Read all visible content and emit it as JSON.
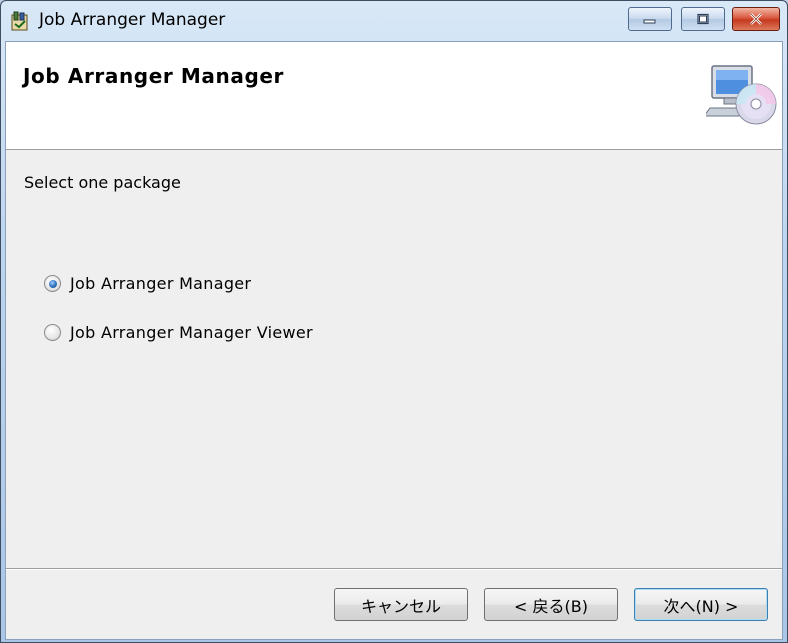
{
  "window": {
    "title": "Job Arranger Manager"
  },
  "banner": {
    "title": "Job Arranger Manager"
  },
  "content": {
    "prompt": "Select one package",
    "options": [
      {
        "label": "Job Arranger Manager",
        "selected": true
      },
      {
        "label": "Job Arranger Manager Viewer",
        "selected": false
      }
    ]
  },
  "footer": {
    "cancel_label": "キャンセル",
    "back_label": "< 戻る(B)",
    "next_label": "次へ(N) >"
  },
  "icons": {
    "app": "installer-box-icon",
    "banner": "computer-with-disc-icon"
  },
  "colors": {
    "accent": "#2b6fbd",
    "close_button": "#c43a1f"
  }
}
